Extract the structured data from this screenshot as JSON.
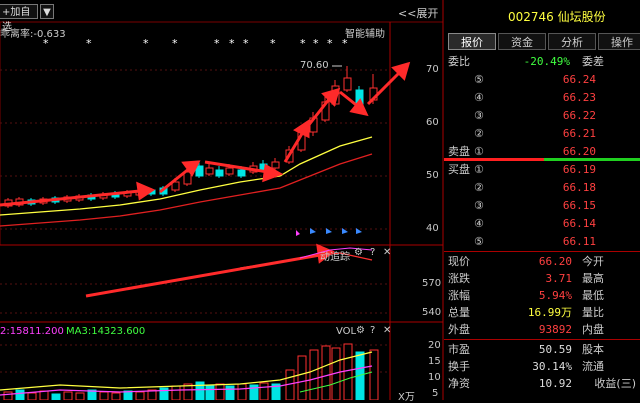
{
  "header": {
    "dropdown_label": "+加自选",
    "expand_label": "<<展开",
    "stock_title": "002746 仙坛股份"
  },
  "chart": {
    "indicator_label": "乖离率:-0.633",
    "assist_label": "智能辅助",
    "price_marker": "70.60",
    "y_axis": [
      "70",
      "60",
      "50",
      "40"
    ],
    "track_label": "动追踪",
    "mid_axis": [
      "570",
      "540"
    ],
    "vol_ma2": "2:15811.200",
    "vol_ma3": "MA3:14323.600",
    "vol_label": "VOL",
    "vol_axis": [
      "20",
      "15",
      "10",
      "5"
    ],
    "vol_unit": "X万",
    "colors": {
      "up": "#ff3030",
      "down": "#00e5e5",
      "ma5": "#ffff40",
      "ma10": "#ff3030"
    }
  },
  "tabs": [
    "报价",
    "资金",
    "分析",
    "操作"
  ],
  "orderbook": {
    "weibi_label": "委比",
    "weibi_value": "-20.49%",
    "weicha_label": "委差",
    "sell": [
      {
        "num": "⑤",
        "price": "66.24"
      },
      {
        "num": "④",
        "price": "66.23"
      },
      {
        "num": "③",
        "price": "66.22"
      },
      {
        "num": "②",
        "price": "66.21"
      },
      {
        "num": "①",
        "price": "66.20",
        "name": "卖盘"
      }
    ],
    "buy": [
      {
        "num": "①",
        "price": "66.19",
        "name": "买盘"
      },
      {
        "num": "②",
        "price": "66.18"
      },
      {
        "num": "③",
        "price": "66.15"
      },
      {
        "num": "④",
        "price": "66.14"
      },
      {
        "num": "⑤",
        "price": "66.11"
      }
    ]
  },
  "stats": [
    {
      "k": "现价",
      "v": "66.20",
      "k2": "今开",
      "color": "#ff4040"
    },
    {
      "k": "涨跌",
      "v": "3.71",
      "k2": "最高",
      "color": "#ff4040"
    },
    {
      "k": "涨幅",
      "v": "5.94%",
      "k2": "最低",
      "color": "#ff4040"
    },
    {
      "k": "总量",
      "v": "16.99万",
      "k2": "量比",
      "color": "#ffff40"
    },
    {
      "k": "外盘",
      "v": "93892",
      "k2": "内盘",
      "color": "#ff4040"
    },
    {
      "k": "市盈",
      "v": "50.59",
      "k2": "股本",
      "color": "#dddddd"
    },
    {
      "k": "换手",
      "v": "30.14%",
      "k2": "流通",
      "color": "#dddddd"
    },
    {
      "k": "净资",
      "v": "10.92",
      "k2": "收益(三)",
      "color": "#dddddd"
    }
  ]
}
